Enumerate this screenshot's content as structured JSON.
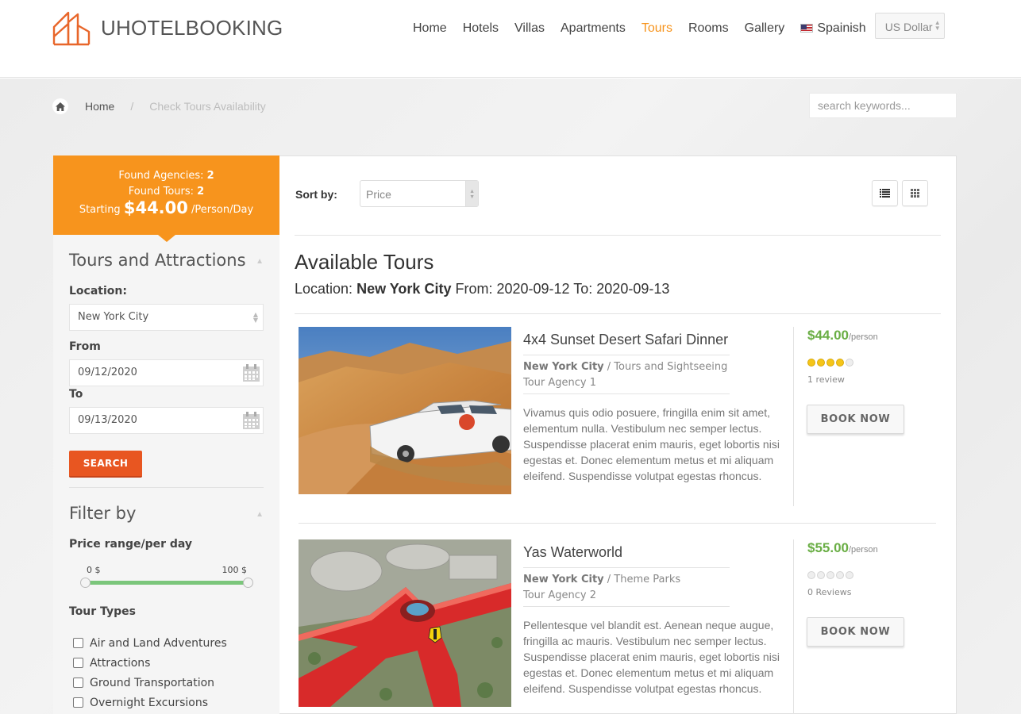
{
  "brand": {
    "name": "UHOTELBOOKING",
    "accent": "#f7941d"
  },
  "nav": {
    "items": [
      {
        "label": "Home"
      },
      {
        "label": "Hotels"
      },
      {
        "label": "Villas"
      },
      {
        "label": "Apartments"
      },
      {
        "label": "Tours",
        "active": true
      },
      {
        "label": "Rooms"
      },
      {
        "label": "Gallery"
      }
    ],
    "language": "Spainish",
    "currency": "US Dollar"
  },
  "breadcrumb": {
    "home": "Home",
    "separator": "/",
    "current": "Check Tours Availability"
  },
  "search": {
    "placeholder": "search keywords..."
  },
  "summary": {
    "agencies_label": "Found Agencies:",
    "agencies": "2",
    "tours_label": "Found Tours:",
    "tours": "2",
    "starting_label": "Starting",
    "starting_price": "$44.00",
    "per_label": "/Person/Day"
  },
  "sidebar": {
    "title": "Tours and Attractions",
    "location_label": "Location:",
    "location": "New York City",
    "from_label": "From",
    "from": "09/12/2020",
    "to_label": "To",
    "to": "09/13/2020",
    "search_button": "SEARCH",
    "filter_title": "Filter by",
    "price_label": "Price range/per day",
    "price_min": "0 $",
    "price_max": "100 $",
    "types_label": "Tour Types",
    "types": [
      "Air and Land Adventures",
      "Attractions",
      "Ground Transportation",
      "Overnight Excursions"
    ]
  },
  "main": {
    "sort_label": "Sort by:",
    "sort_value": "Price",
    "title": "Available Tours",
    "location_prefix": "Location:",
    "location": "New York City",
    "from_prefix": "From:",
    "from": "2020-09-12",
    "to_prefix": "To:",
    "to": "2020-09-13",
    "tours": [
      {
        "title": "4x4 Sunset Desert Safari Dinner",
        "city": "New York City",
        "category": "/ Tours and Sightseeing",
        "agency": "Tour Agency 1",
        "description": "Vivamus quis odio posuere, fringilla enim sit amet, elementum nulla. Vestibulum nec semper lectus. Suspendisse placerat enim mauris, eget lobortis nisi egestas et. Donec elementum metus et mi aliquam eleifend. Suspendisse volutpat egestas rhoncus.",
        "price": "$44.00",
        "per": "/person",
        "rating": 4,
        "review": "1 review",
        "book": "BOOK NOW"
      },
      {
        "title": "Yas Waterworld",
        "city": "New York City",
        "category": "/ Theme Parks",
        "agency": "Tour Agency 2",
        "description": "Pellentesque vel blandit est. Aenean neque augue, fringilla ac mauris. Vestibulum nec semper lectus. Suspendisse placerat enim mauris, eget lobortis nisi egestas et. Donec elementum metus et mi aliquam eleifend. Suspendisse volutpat egestas rhoncus.",
        "price": "$55.00",
        "per": "/person",
        "rating": 0,
        "review": "0 Reviews",
        "book": "BOOK NOW"
      }
    ]
  }
}
